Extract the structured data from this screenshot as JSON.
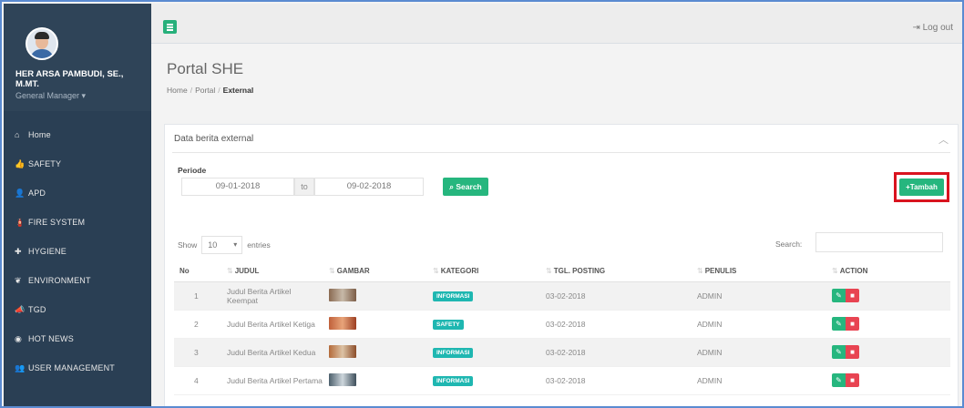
{
  "sidebar": {
    "user_name": "HER ARSA PAMBUDI, SE., M.MT.",
    "user_role": "General Manager",
    "items": [
      {
        "label": "Home",
        "icon": "home-icon",
        "glyph": "⌂"
      },
      {
        "label": "SAFETY",
        "icon": "thumbs-up-icon",
        "glyph": "👍"
      },
      {
        "label": "APD",
        "icon": "user-icon",
        "glyph": "👤"
      },
      {
        "label": "FIRE SYSTEM",
        "icon": "fire-extinguisher-icon",
        "glyph": "🧯"
      },
      {
        "label": "HYGIENE",
        "icon": "medkit-icon",
        "glyph": "✚"
      },
      {
        "label": "ENVIRONMENT",
        "icon": "leaf-icon",
        "glyph": "❦"
      },
      {
        "label": "TGD",
        "icon": "bullhorn-icon",
        "glyph": "📣"
      },
      {
        "label": "HOT NEWS",
        "icon": "globe-icon",
        "glyph": "◉"
      },
      {
        "label": "USER MANAGEMENT",
        "icon": "users-icon",
        "glyph": "👥"
      }
    ]
  },
  "topbar": {
    "logout_label": "Log out",
    "logout_icon": "sign-out-icon"
  },
  "header": {
    "title": "Portal SHE",
    "breadcrumb": [
      "Home",
      "Portal",
      "External"
    ]
  },
  "panel": {
    "title": "Data berita external",
    "periode_label": "Periode",
    "date_from": "09-01-2018",
    "to_label": "to",
    "date_to": "09-02-2018",
    "search_button": "Search",
    "tambah_button": "Tambah",
    "show_label": "Show",
    "entries_value": "10",
    "entries_label": "entries",
    "search_label": "Search:",
    "search_value": ""
  },
  "table": {
    "columns": [
      "No",
      "JUDUL",
      "GAMBAR",
      "KATEGORI",
      "TGL. POSTING",
      "PENULIS",
      "ACTION"
    ],
    "rows": [
      {
        "no": "1",
        "judul": "Judul Berita Artikel Keempat",
        "kategori": "INFORMASI",
        "tgl": "03-02-2018",
        "penulis": "ADMIN",
        "thumb_color": "#9a7c64"
      },
      {
        "no": "2",
        "judul": "Judul Berita Artikel Ketiga",
        "kategori": "SAFETY",
        "tgl": "03-02-2018",
        "penulis": "ADMIN",
        "thumb_color": "#b5552e"
      },
      {
        "no": "3",
        "judul": "Judul Berita Artikel Kedua",
        "kategori": "INFORMASI",
        "tgl": "03-02-2018",
        "penulis": "ADMIN",
        "thumb_color": "#a86a3c"
      },
      {
        "no": "4",
        "judul": "Judul Berita Artikel Pertama",
        "kategori": "INFORMASI",
        "tgl": "03-02-2018",
        "penulis": "ADMIN",
        "thumb_color": "#5a6f7d"
      }
    ]
  },
  "colors": {
    "sidebar": "#2a3f54",
    "accent": "#26b67e",
    "danger": "#e84452",
    "badge": "#1fb7b1",
    "highlight": "#d9141f"
  }
}
